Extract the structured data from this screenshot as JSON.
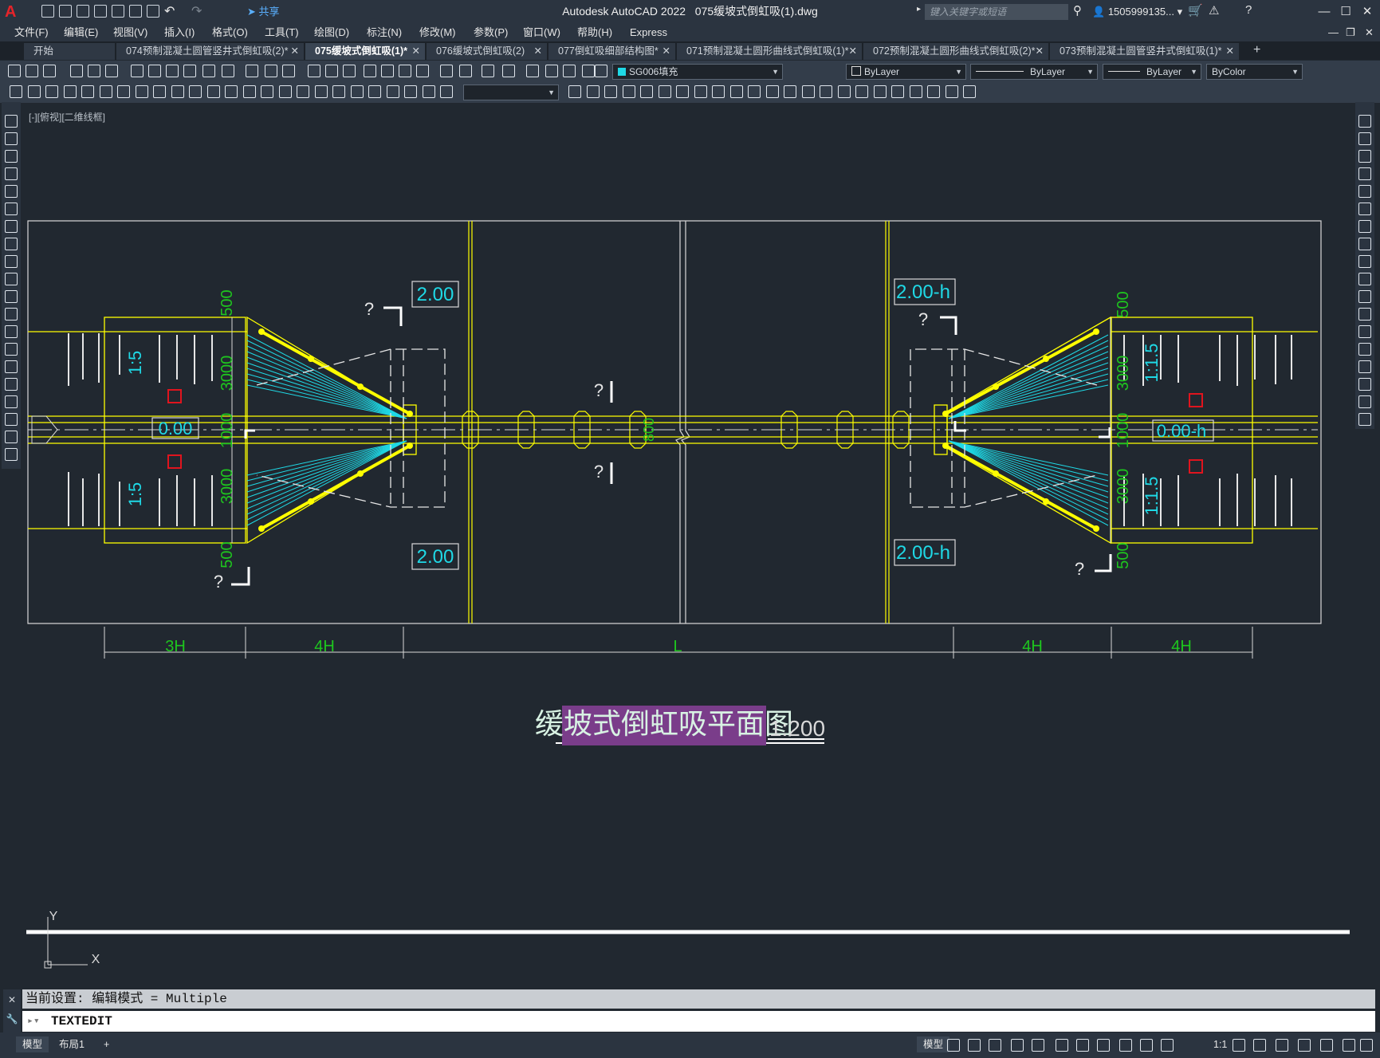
{
  "titlebar": {
    "app_title": "Autodesk AutoCAD 2022",
    "file_name": "075缓坡式倒虹吸(1).dwg",
    "share_label": "共享",
    "search_placeholder": "键入关键字或短语",
    "user": "1505999135...",
    "logo_letter": "A"
  },
  "menu": [
    "文件(F)",
    "编辑(E)",
    "视图(V)",
    "插入(I)",
    "格式(O)",
    "工具(T)",
    "绘图(D)",
    "标注(N)",
    "修改(M)",
    "参数(P)",
    "窗口(W)",
    "帮助(H)",
    "Express"
  ],
  "tabs": [
    {
      "label": "开始",
      "closable": false,
      "active": false
    },
    {
      "label": "074预制混凝土圆管竖井式倒虹吸(2)*",
      "closable": true,
      "active": false
    },
    {
      "label": "075缓坡式倒虹吸(1)*",
      "closable": true,
      "active": true
    },
    {
      "label": "076缓坡式倒虹吸(2)",
      "closable": true,
      "active": false
    },
    {
      "label": "077倒虹吸细部结构图*",
      "closable": true,
      "active": false
    },
    {
      "label": "071预制混凝土圆形曲线式倒虹吸(1)*",
      "closable": true,
      "active": false
    },
    {
      "label": "072预制混凝土圆形曲线式倒虹吸(2)*",
      "closable": true,
      "active": false
    },
    {
      "label": "073预制混凝土圆管竖井式倒虹吸(1)*",
      "closable": true,
      "active": false
    }
  ],
  "tab_close_glyph": "✕",
  "tab_add_glyph": "+",
  "properties": {
    "layer": "SG006填充",
    "color": "ByLayer",
    "linetype": "ByLayer",
    "lineweight": "ByLayer",
    "plotstyle": "ByColor",
    "textstyle": ""
  },
  "viewport_label": "[-][俯视][二维线框]",
  "drawing": {
    "title": "缓坡式倒虹吸平面图",
    "scale": "1:200",
    "levels": {
      "left_top": "2.00",
      "left_bottom": "2.00",
      "left_mid": "0.00",
      "right_top": "2.00-h",
      "right_bottom": "2.00-h",
      "right_mid": "0.00-h"
    },
    "slopes": {
      "left_top": "1:5",
      "left_bottom": "1:5",
      "right_top": "1:1.5",
      "right_bottom": "1:1.5"
    },
    "dims_vertical": {
      "top": "500",
      "upper": "3000",
      "middle": "1000",
      "lower": "3000",
      "bottom": "500"
    },
    "pipe_label": "800",
    "section_mark": "?",
    "bottom_dims": [
      "3H",
      "4H",
      "L",
      "4H",
      "4H"
    ],
    "ucs": {
      "x": "X",
      "y": "Y"
    }
  },
  "command": {
    "history": "当前设置: 编辑模式 = Multiple",
    "input": "TEXTEDIT"
  },
  "layout_tabs": [
    "模型",
    "布局1"
  ],
  "layout_add": "+",
  "status": {
    "model": "模型",
    "scale": "1:1"
  },
  "colors": {
    "background": "#212830",
    "yellow": "#ffff00",
    "cyan": "#1fd9e6",
    "green": "#1ec61e",
    "white": "#ffffff",
    "red": "#e0141e",
    "title_bg": "#7a3d8a"
  }
}
